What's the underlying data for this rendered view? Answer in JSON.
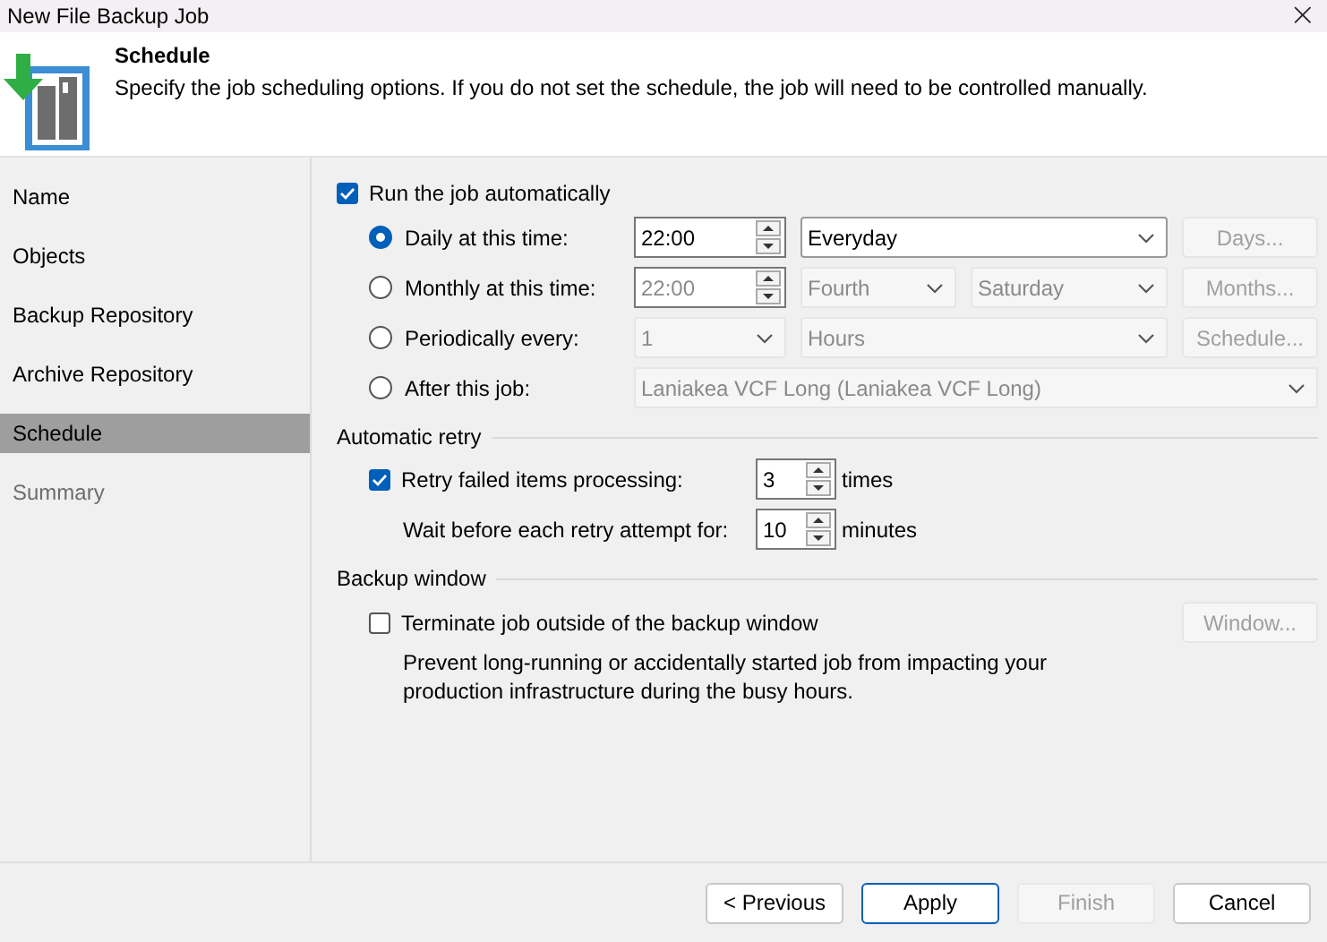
{
  "window": {
    "title": "New File Backup Job",
    "close": "×"
  },
  "header": {
    "title": "Schedule",
    "description": "Specify the job scheduling options. If you do not set the schedule, the job will need to be controlled manually."
  },
  "sidebar": {
    "items": [
      {
        "label": "Name",
        "selected": false,
        "disabled": false
      },
      {
        "label": "Objects",
        "selected": false,
        "disabled": false
      },
      {
        "label": "Backup Repository",
        "selected": false,
        "disabled": false
      },
      {
        "label": "Archive Repository",
        "selected": false,
        "disabled": false
      },
      {
        "label": "Schedule",
        "selected": true,
        "disabled": false
      },
      {
        "label": "Summary",
        "selected": false,
        "disabled": true
      }
    ]
  },
  "run_automatically": {
    "label": "Run the job automatically",
    "checked": true
  },
  "schedule_options": [
    {
      "label": "Daily at this time:",
      "selected": true,
      "controls": [
        {
          "kind": "spin",
          "value": "22:00",
          "disabled": false
        },
        {
          "kind": "dropdown",
          "value": "Everyday",
          "disabled": false
        }
      ],
      "button": {
        "label": "Days...",
        "disabled": true
      }
    },
    {
      "label": "Monthly at this time:",
      "selected": false,
      "controls": [
        {
          "kind": "spin",
          "value": "22:00",
          "disabled": true
        },
        {
          "kind": "dropdown",
          "value": "Fourth",
          "disabled": true
        },
        {
          "kind": "dropdown",
          "value": "Saturday",
          "disabled": true
        }
      ],
      "button": {
        "label": "Months...",
        "disabled": true
      }
    },
    {
      "label": "Periodically every:",
      "selected": false,
      "controls": [
        {
          "kind": "dropdown",
          "value": "1",
          "disabled": true
        },
        {
          "kind": "dropdown",
          "value": "Hours",
          "disabled": true
        }
      ],
      "button": {
        "label": "Schedule...",
        "disabled": true
      }
    },
    {
      "label": "After this job:",
      "selected": false,
      "controls": [
        {
          "kind": "dropdown",
          "value": "Laniakea VCF Long (Laniakea VCF Long)",
          "disabled": true
        }
      ]
    }
  ],
  "automatic_retry": {
    "title": "Automatic retry",
    "retry": {
      "label": "Retry failed items processing:",
      "checked": true,
      "value": "3",
      "unit": "times"
    },
    "wait": {
      "label": "Wait before each retry attempt for:",
      "value": "10",
      "unit": "minutes"
    }
  },
  "backup_window": {
    "title": "Backup window",
    "terminate": {
      "label": "Terminate job outside of the backup window",
      "checked": false
    },
    "button": {
      "label": "Window...",
      "disabled": true
    },
    "description": "Prevent long-running or accidentally started job from impacting your production infrastructure during the busy hours."
  },
  "footer": {
    "buttons": [
      {
        "label": "< Previous",
        "kind": "normal",
        "disabled": false
      },
      {
        "label": "Apply",
        "kind": "default",
        "disabled": false
      },
      {
        "label": "Finish",
        "kind": "normal",
        "disabled": true
      },
      {
        "label": "Cancel",
        "kind": "normal",
        "disabled": false
      }
    ]
  }
}
